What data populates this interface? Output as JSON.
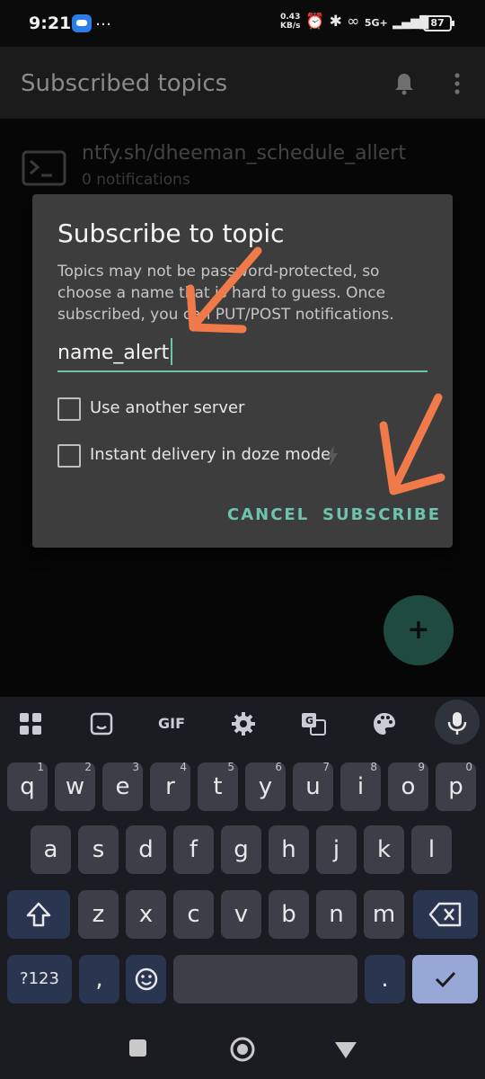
{
  "status_bar": {
    "time": "9:21",
    "more": "…",
    "net_speed_value": "0.43",
    "net_speed_unit": "KB/s",
    "network": "5G+",
    "battery": "87"
  },
  "app_bar": {
    "title": "Subscribed topics"
  },
  "topic": {
    "name": "ntfy.sh/dheeman_schedule_allert",
    "count": "0 notifications"
  },
  "dialog": {
    "title": "Subscribe to topic",
    "description": "Topics may not be password-protected, so choose a name that is hard to guess. Once subscribed, you can PUT/POST notifications.",
    "input_value": "name_alert",
    "checkbox_server": "Use another server",
    "checkbox_doze": "Instant delivery in doze mode",
    "cancel": "CANCEL",
    "subscribe": "SUBSCRIBE"
  },
  "fab": {
    "label": "+"
  },
  "keyboard": {
    "toolbar": [
      "apps-grid-icon",
      "sticker-icon",
      "GIF",
      "settings-icon",
      "translate-icon",
      "palette-icon",
      "mic-icon"
    ],
    "row1": [
      [
        "q",
        "1"
      ],
      [
        "w",
        "2"
      ],
      [
        "e",
        "3"
      ],
      [
        "r",
        "4"
      ],
      [
        "t",
        "5"
      ],
      [
        "y",
        "6"
      ],
      [
        "u",
        "7"
      ],
      [
        "i",
        "8"
      ],
      [
        "o",
        "9"
      ],
      [
        "p",
        "0"
      ]
    ],
    "row2": [
      "a",
      "s",
      "d",
      "f",
      "g",
      "h",
      "j",
      "k",
      "l"
    ],
    "row3": [
      "z",
      "x",
      "c",
      "v",
      "b",
      "n",
      "m"
    ],
    "symbols": "?123",
    "comma": ",",
    "period": "."
  },
  "colors": {
    "accent": "#6ec3ad",
    "dialog_bg": "#3d3d3d",
    "annotation_arrow": "#f07a4a",
    "fab": "#1e4a40"
  }
}
